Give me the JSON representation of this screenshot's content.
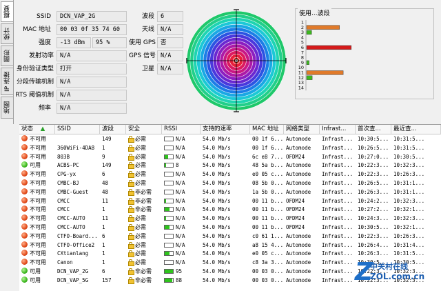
{
  "tabs": [
    "概要",
    "统计",
    "图形",
    "IP 连接",
    "地图"
  ],
  "info": {
    "ssid_label": "SSID",
    "ssid": "DCN_VAP_2G",
    "mac_label": "MAC 地址",
    "mac": "00 03 0f 35 74 60",
    "strength_label": "强度",
    "strength_dbm": "-13 dBm",
    "strength_pct": "95 %",
    "txpower_label": "发射功率",
    "txpower": "N/A",
    "auth_label": "身份验证类型",
    "auth": "打开",
    "frag_label": "分段传输机制",
    "frag": "N/A",
    "rts_label": "RTS 阈值机制",
    "rts": "N/A",
    "freq_label": "频率",
    "freq": "N/A",
    "channel_label": "波段",
    "channel": "6",
    "antenna_label": "天线",
    "antenna": "N/A",
    "gps_label": "使用 GPS",
    "gps": "否",
    "gps_signal_label": "GPS 信号",
    "gps_signal": "N/A",
    "satellite_label": "卫星",
    "satellite": "N/A"
  },
  "channel_chart": {
    "title": "使用...波段",
    "channels": [
      "1",
      "2",
      "3",
      "4",
      "5",
      "6",
      "7",
      "8",
      "9",
      "10",
      "11",
      "12",
      "13",
      "14"
    ]
  },
  "chart_data": {
    "type": "bar",
    "title": "使用...波段",
    "categories": [
      "1",
      "2",
      "3",
      "4",
      "5",
      "6",
      "7",
      "8",
      "9",
      "10",
      "11",
      "12",
      "13",
      "14"
    ],
    "series": [
      {
        "name": "orange",
        "color": "#e07a2a",
        "values": [
          0,
          0.53,
          0,
          0,
          0,
          0,
          0,
          0,
          0,
          0,
          0.59,
          0,
          0,
          0
        ]
      },
      {
        "name": "green",
        "color": "#3cb81e",
        "values": [
          0,
          0,
          0.08,
          0,
          0,
          0,
          0,
          0,
          0.04,
          0,
          0,
          0.09,
          0,
          0
        ]
      },
      {
        "name": "red",
        "color": "#d41a1a",
        "values": [
          0,
          0,
          0,
          0,
          0,
          0.72,
          0,
          0,
          0,
          0,
          0,
          0,
          0,
          0
        ]
      }
    ]
  },
  "table": {
    "headers": [
      "状态",
      "SSID",
      "波段",
      "安全",
      "RSSI",
      "支持的速率",
      "MAC 地址",
      "网络类型",
      "Infrast...",
      "首次查...",
      "最近查..."
    ],
    "rows": [
      {
        "status": "不可用",
        "ok": false,
        "ssid": "",
        "ch": "149",
        "sec": "必需",
        "rssi": "N/A",
        "bar": 0,
        "rate": "54.0 Mb/s",
        "mac": "00 1f 6...",
        "net": "Automode",
        "infra": "Infrast...",
        "first": "10:30:5...",
        "last": "10:31:5..."
      },
      {
        "status": "不可用",
        "ok": false,
        "ssid": "360WiFi-4DA8",
        "ch": "1",
        "sec": "必需",
        "rssi": "N/A",
        "bar": 0,
        "rate": "54.0 Mb/s",
        "mac": "00 1f 6...",
        "net": "Automode",
        "infra": "Infrast...",
        "first": "10:26:5...",
        "last": "10:31:5..."
      },
      {
        "status": "不可用",
        "ok": false,
        "ssid": "803B",
        "ch": "9",
        "sec": "必需",
        "rssi": "N/A",
        "bar": 0.4,
        "rate": "54.0 Mb/s",
        "mac": "6c e8 7...",
        "net": "OFDM24",
        "infra": "Infrast...",
        "first": "10:27:0...",
        "last": "10:30:5..."
      },
      {
        "status": "可用",
        "ok": true,
        "ssid": "ACBS-PC",
        "ch": "149",
        "sec": "必需",
        "rssi": "8",
        "bar": 0.2,
        "rate": "54.0 Mb/s",
        "mac": "48 5a b...",
        "net": "Automode",
        "infra": "Infrast...",
        "first": "10:22:3...",
        "last": "10:32:3..."
      },
      {
        "status": "不可用",
        "ok": false,
        "ssid": "CPG-yx",
        "ch": "6",
        "sec": "必需",
        "rssi": "N/A",
        "bar": 0,
        "rate": "54.0 Mb/s",
        "mac": "e0 05 c...",
        "net": "Automode",
        "infra": "Infrast...",
        "first": "10:22:3...",
        "last": "10:26:3..."
      },
      {
        "status": "不可用",
        "ok": false,
        "ssid": "CMBC-BJ",
        "ch": "48",
        "sec": "必需",
        "rssi": "N/A",
        "bar": 0,
        "rate": "54.0 Mb/s",
        "mac": "08 5b 0...",
        "net": "Automode",
        "infra": "Infrast...",
        "first": "10:26:5...",
        "last": "10:31:1..."
      },
      {
        "status": "不可用",
        "ok": false,
        "ssid": "CMBC-Guest",
        "ch": "48",
        "sec": "非必需",
        "rssi": "N/A",
        "bar": 0,
        "rate": "54.0 Mb/s",
        "mac": "1a 5b 0...",
        "net": "Automode",
        "infra": "Infrast...",
        "first": "10:26:3...",
        "last": "10:31:1..."
      },
      {
        "status": "不可用",
        "ok": false,
        "ssid": "CMCC",
        "ch": "11",
        "sec": "非必需",
        "rssi": "N/A",
        "bar": 0.2,
        "rate": "54.0 Mb/s",
        "mac": "00 11 b...",
        "net": "OFDM24",
        "infra": "Infrast...",
        "first": "10:24:2...",
        "last": "10:32:3..."
      },
      {
        "status": "不可用",
        "ok": false,
        "ssid": "CMCC",
        "ch": "1",
        "sec": "非必需",
        "rssi": "N/A",
        "bar": 0.6,
        "rate": "54.0 Mb/s",
        "mac": "00 11 b...",
        "net": "OFDM24",
        "infra": "Infrast...",
        "first": "10:27:2...",
        "last": "10:32:1..."
      },
      {
        "status": "不可用",
        "ok": false,
        "ssid": "CMCC-AUTO",
        "ch": "11",
        "sec": "必需",
        "rssi": "N/A",
        "bar": 0.2,
        "rate": "54.0 Mb/s",
        "mac": "00 11 b...",
        "net": "OFDM24",
        "infra": "Infrast...",
        "first": "10:24:3...",
        "last": "10:32:3..."
      },
      {
        "status": "不可用",
        "ok": false,
        "ssid": "CMCC-AUTO",
        "ch": "1",
        "sec": "必需",
        "rssi": "N/A",
        "bar": 0.6,
        "rate": "54.0 Mb/s",
        "mac": "00 11 b...",
        "net": "OFDM24",
        "infra": "Infrast...",
        "first": "10:30:5...",
        "last": "10:32:1..."
      },
      {
        "status": "不可用",
        "ok": false,
        "ssid": "CTFO-Board...",
        "ch": "6",
        "sec": "必需",
        "rssi": "N/A",
        "bar": 0,
        "rate": "54.0 Mb/s",
        "mac": "c0 61 1...",
        "net": "Automode",
        "infra": "Infrast...",
        "first": "10:22:3...",
        "last": "10:26:3..."
      },
      {
        "status": "不可用",
        "ok": false,
        "ssid": "CTFO-Office2",
        "ch": "1",
        "sec": "必需",
        "rssi": "N/A",
        "bar": 0,
        "rate": "54.0 Mb/s",
        "mac": "a8 15 4...",
        "net": "Automode",
        "infra": "Infrast...",
        "first": "10:26:4...",
        "last": "10:31:4..."
      },
      {
        "status": "不可用",
        "ok": false,
        "ssid": "CXtianlang",
        "ch": "1",
        "sec": "必需",
        "rssi": "N/A",
        "bar": 0.6,
        "rate": "54.0 Mb/s",
        "mac": "e0 05 c...",
        "net": "Automode",
        "infra": "Infrast...",
        "first": "10:26:3...",
        "last": "10:31:5..."
      },
      {
        "status": "不可用",
        "ok": false,
        "ssid": "Canon",
        "ch": "1",
        "sec": "必需",
        "rssi": "N/A",
        "bar": 0,
        "rate": "54.0 Mb/s",
        "mac": "c8 3a 3...",
        "net": "Automode",
        "infra": "Infrast...",
        "first": "10:30:5...",
        "last": "10:30:5..."
      },
      {
        "status": "可用",
        "ok": true,
        "ssid": "DCN_VAP_2G",
        "ch": "6",
        "sec": "非必需",
        "rssi": "95",
        "bar": 1,
        "rate": "54.0 Mb/s",
        "mac": "00 03 0...",
        "net": "Automode",
        "infra": "Infrast...",
        "first": "10:22:3...",
        "last": "10:32:3..."
      },
      {
        "status": "可用",
        "ok": true,
        "ssid": "DCN_VAP_5G",
        "ch": "157",
        "sec": "非必需",
        "rssi": "88",
        "bar": 0.9,
        "rate": "54.0 Mb/s",
        "mac": "00 03 0...",
        "net": "Automode",
        "infra": "Infrast...",
        "first": "10:22:3...",
        "last": "10:32:3..."
      }
    ]
  },
  "watermark": {
    "cn": "中关村在线",
    "en": "ZOL.com.cn",
    "z": "Z"
  }
}
